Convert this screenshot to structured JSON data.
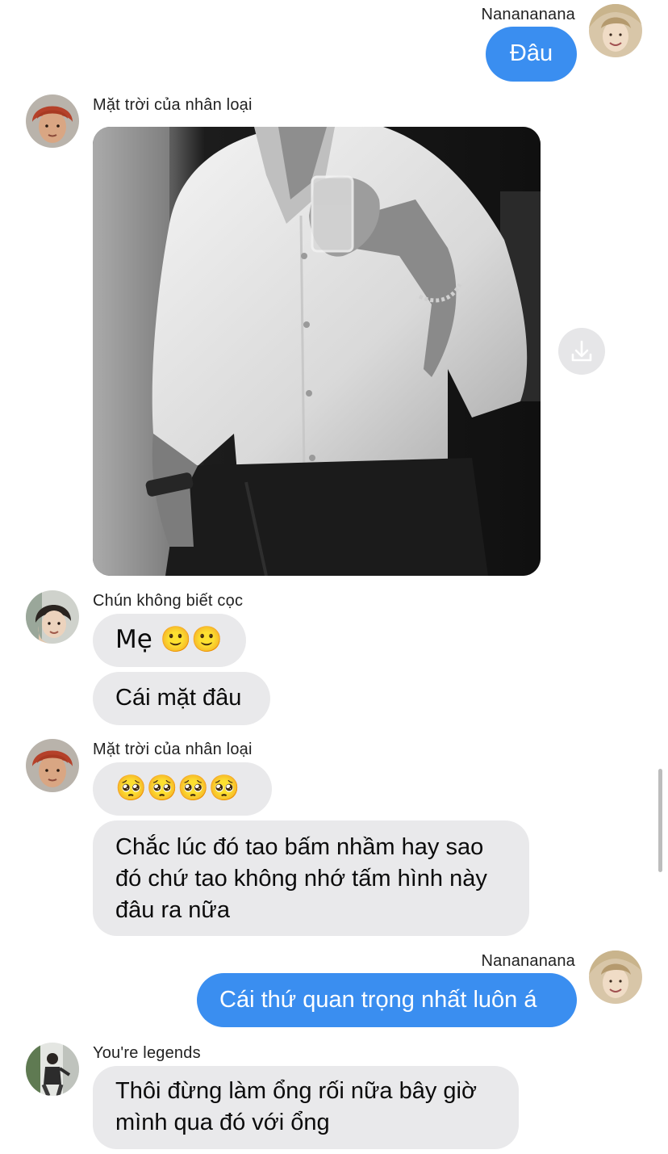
{
  "messages": [
    {
      "sender": "Nanananana",
      "text": "Đâu"
    },
    {
      "sender": "Mặt trời của nhân loại",
      "image": "photo-man-white-shirt"
    },
    {
      "sender": "Chún không biết cọc",
      "text": "Mẹ 🙂🙂"
    },
    {
      "sender": "Chún không biết cọc",
      "text": "Cái mặt đâu"
    },
    {
      "sender": "Mặt trời của nhân loại",
      "text": "🥺🥺🥺🥺"
    },
    {
      "sender": "Mặt trời của nhân loại",
      "text": "Chắc lúc đó tao bấm nhầm hay sao đó chứ tao không nhớ tấm hình này đâu ra nữa"
    },
    {
      "sender": "Nanananana",
      "text": "Cái thứ quan trọng nhất luôn á"
    },
    {
      "sender": "You're legends",
      "text": "Thôi đừng làm ổng rối nữa bây giờ mình qua đó với ổng"
    }
  ],
  "text_lines": {
    "m6_line1": "Chắc lúc đó tao bấm nhầm hay sao",
    "m6_line2": "đó chứ tao không nhớ tấm hình này",
    "m6_line3": "đâu ra nữa",
    "m8_line1": "Thôi đừng làm ổng rối nữa bây giờ",
    "m8_line2": "mình qua đó với ổng"
  },
  "colors": {
    "outgoing_bubble": "#3a8ef0",
    "incoming_bubble": "#e9e9eb"
  },
  "icons": {
    "download": "download-icon"
  }
}
